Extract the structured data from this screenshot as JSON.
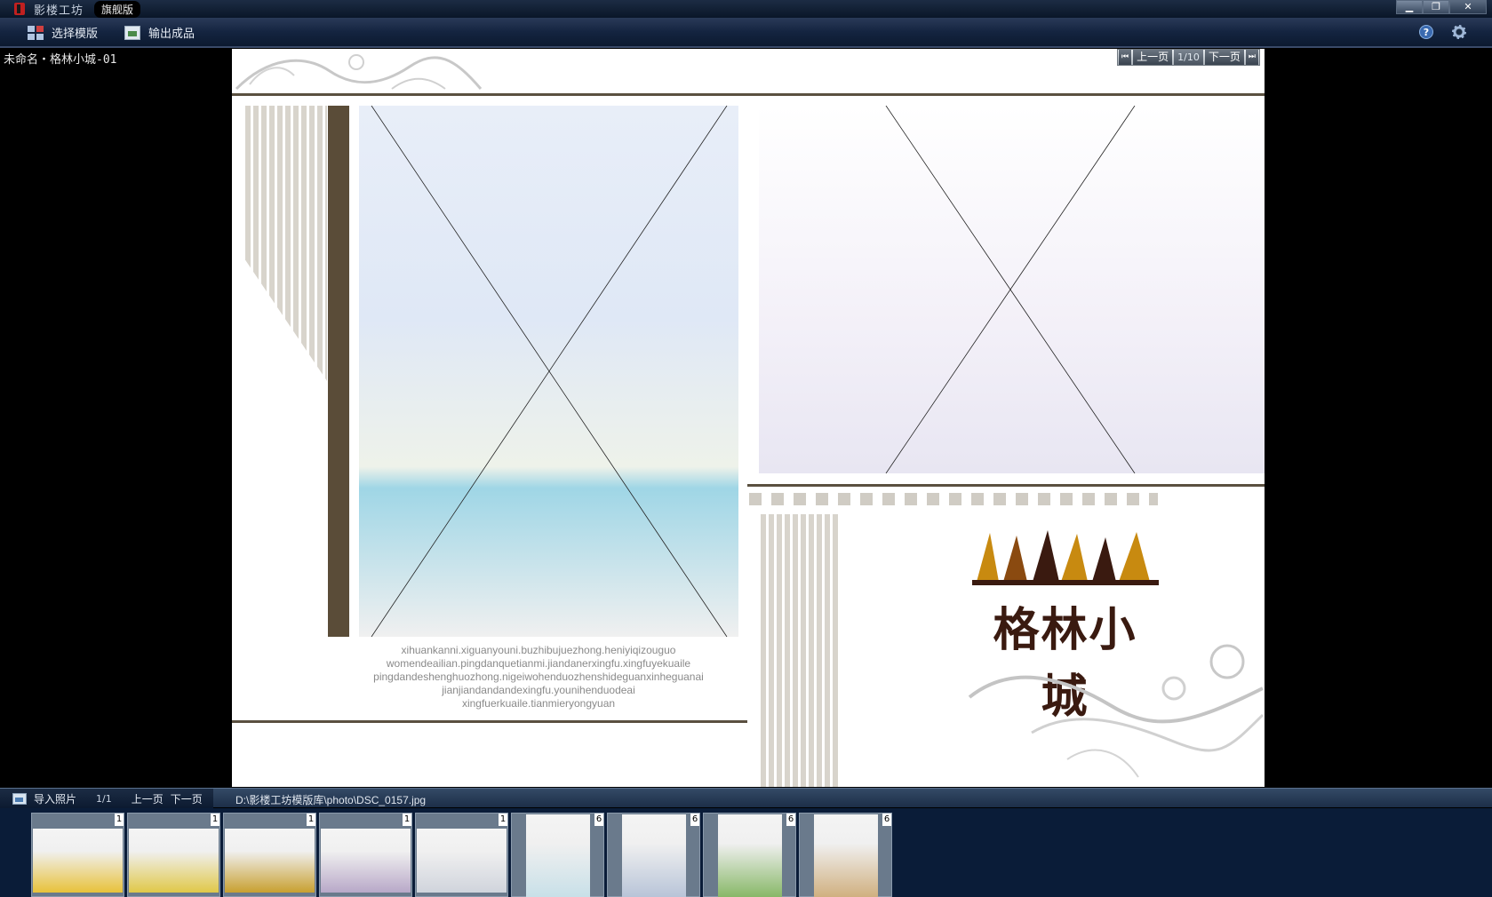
{
  "titlebar": {
    "app_title": "影楼工坊",
    "edition": "旗舰版"
  },
  "toolbar": {
    "select_template": "选择模版",
    "export_product": "输出成品"
  },
  "project": {
    "name": "未命名・格林小城-01"
  },
  "pager": {
    "prev": "上一页",
    "count": "1/10",
    "next": "下一页"
  },
  "page": {
    "caption": [
      "xihuankanni.xiguanyouni.buzhibujuezhong.heniyiqizouguo",
      "womendeailian.pingdanquetianmi.jiandanerxingfu.xingfuyekuaile",
      "pingdandeshenghuozhong.nigeiwohenduozhenshideguanxinheguanai",
      "jianjiandandandexingfu.younihenduodeai",
      "xingfuerkuaile.tianmieryongyuan"
    ],
    "logo_text": "格林小城"
  },
  "filmstrip": {
    "import_label": "导入照片",
    "page_count": "1/1",
    "prev": "上一页",
    "next": "下一页",
    "path": "D:\\影楼工坊模版库\\photo\\DSC_0157.jpg",
    "thumbnails": [
      {
        "badge": "1",
        "orientation": "landscape",
        "color": "#e8c23a"
      },
      {
        "badge": "1",
        "orientation": "landscape",
        "color": "#e0c848"
      },
      {
        "badge": "1",
        "orientation": "landscape",
        "color": "#c8a030"
      },
      {
        "badge": "1",
        "orientation": "landscape",
        "color": "#b8a8c8"
      },
      {
        "badge": "1",
        "orientation": "landscape",
        "color": "#d0d4dc"
      },
      {
        "badge": "6",
        "orientation": "portrait",
        "color": "#c8e0e8"
      },
      {
        "badge": "6",
        "orientation": "portrait",
        "color": "#b8c4d8"
      },
      {
        "badge": "6",
        "orientation": "portrait",
        "color": "#88b868"
      },
      {
        "badge": "6",
        "orientation": "portrait",
        "color": "#d0b080"
      }
    ]
  },
  "colors": {
    "frame_brown": "#5a4c38",
    "logo_brown": "#3a1a10",
    "logo_gold": "#c88a10",
    "titlebar": "#0a1628"
  }
}
